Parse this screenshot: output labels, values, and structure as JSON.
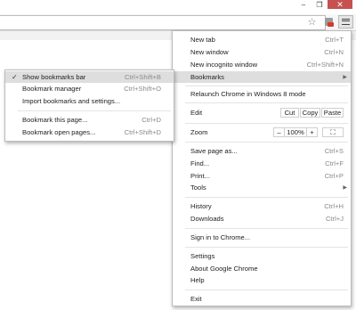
{
  "window": {
    "minimize_glyph": "–",
    "maximize_glyph": "❐",
    "close_glyph": "✕"
  },
  "toolbar": {
    "star_icon": "star-outline",
    "extension_icon": "extension-badge",
    "menu_icon": "hamburger"
  },
  "menu": {
    "items": [
      {
        "label": "New tab",
        "shortcut": "Ctrl+T"
      },
      {
        "label": "New window",
        "shortcut": "Ctrl+N"
      },
      {
        "label": "New incognito window",
        "shortcut": "Ctrl+Shift+N"
      },
      {
        "label": "Bookmarks",
        "arrow": "▶"
      },
      {
        "label": "Relaunch Chrome in Windows 8 mode"
      },
      {
        "label": "Edit"
      },
      {
        "label": "Zoom"
      },
      {
        "label": "Save page as...",
        "shortcut": "Ctrl+S"
      },
      {
        "label": "Find...",
        "shortcut": "Ctrl+F"
      },
      {
        "label": "Print...",
        "shortcut": "Ctrl+P"
      },
      {
        "label": "Tools",
        "arrow": "▶"
      },
      {
        "label": "History",
        "shortcut": "Ctrl+H"
      },
      {
        "label": "Downloads",
        "shortcut": "Ctrl+J"
      },
      {
        "label": "Sign in to Chrome..."
      },
      {
        "label": "Settings"
      },
      {
        "label": "About Google Chrome"
      },
      {
        "label": "Help"
      },
      {
        "label": "Exit"
      }
    ],
    "edit": {
      "cut": "Cut",
      "copy": "Copy",
      "paste": "Paste"
    },
    "zoom": {
      "minus": "–",
      "level": "100%",
      "plus": "+",
      "fullscreen": "⛶"
    }
  },
  "bookmarks_submenu": {
    "items": [
      {
        "label": "Show bookmarks bar",
        "shortcut": "Ctrl+Shift+B",
        "check": "✓"
      },
      {
        "label": "Bookmark manager",
        "shortcut": "Ctrl+Shift+O"
      },
      {
        "label": "Import bookmarks and settings..."
      },
      {
        "label": "Bookmark this page...",
        "shortcut": "Ctrl+D"
      },
      {
        "label": "Bookmark open pages...",
        "shortcut": "Ctrl+Shift+D"
      }
    ]
  }
}
